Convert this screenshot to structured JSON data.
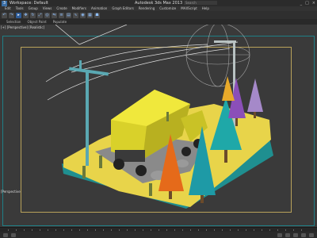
{
  "window": {
    "workspace": "Workspace: Default",
    "title": "Autodesk 3ds Max 2013 x64",
    "file": "Crane",
    "search_placeholder": "Search",
    "buttons": [
      "_",
      "□",
      "×"
    ]
  },
  "menu": [
    "Edit",
    "Tools",
    "Group",
    "Views",
    "Create",
    "Modifiers",
    "Animation",
    "Graph Editors",
    "Rendering",
    "Customize",
    "MAXScript",
    "Help"
  ],
  "ribbon": [
    "Selection",
    "Object Paint",
    "Populate"
  ],
  "viewport": {
    "label": "[+] [Perspective] [Realistic]",
    "label2": "[Perspective]"
  },
  "colors": {
    "accent": "#2f5d9a",
    "safe_frame": "#b9a25a",
    "viewport_frame": "#1f7f86",
    "truck": "#d9d12a",
    "ground": "#e8d44a",
    "tree_teal": "#1fa8a8",
    "tree_purple": "#8b4fb8",
    "tree_orange": "#e56a1a"
  },
  "icons": [
    "undo-icon",
    "redo-icon",
    "select-icon",
    "move-icon",
    "rotate-icon",
    "scale-icon",
    "render-icon"
  ]
}
